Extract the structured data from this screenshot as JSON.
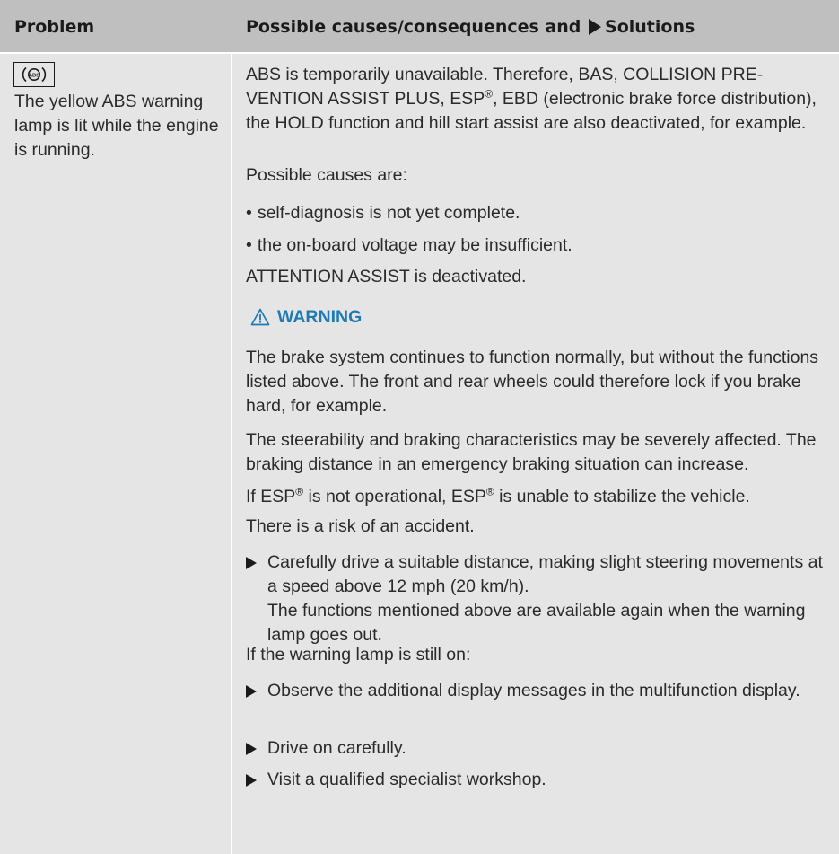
{
  "header": {
    "problem_label": "Problem",
    "solutions_prefix": "Possible causes/consequences and",
    "solutions_suffix": "Solutions"
  },
  "problem": {
    "icon_name": "abs-warning-lamp-icon",
    "text": "The yellow ABS warning lamp is lit while the engine is running."
  },
  "content": {
    "intro_a": "ABS is temporarily unavailable. Therefore, BAS, COLLISION PRE-VENTION ASSIST PLUS, ESP",
    "intro_b": ", EBD (electronic brake force distribution), the HOLD function and hill start assist are also deactivated, for example.",
    "reg_mark": "®",
    "possible_causes": "Possible causes are:",
    "bullets": [
      "self-diagnosis is not yet complete.",
      "the on-board voltage may be insufficient."
    ],
    "attention": "ATTENTION ASSIST is deactivated.",
    "warning_title": "WARNING",
    "warning_p1": "The brake system continues to function normally, but without the functions listed above. The front and rear wheels could therefore lock if you brake hard, for example.",
    "warning_p2": "The steerability and braking characteristics may be severely affected. The braking distance in an emergency braking situation can increase.",
    "esp_a": "If ESP",
    "esp_b": " is not operational, ESP",
    "esp_c": " is unable to stabilize the vehicle.",
    "risk": "There is a risk of an accident.",
    "step1_a": "Carefully drive a suitable distance, making slight steering movements at a speed above 12 mph (20 km/h).",
    "step1_b": "The functions mentioned above are available again when the warning lamp goes out.",
    "still_on": "If the warning lamp is still on:",
    "steps": [
      "Observe the additional display messages in the multifunction display.",
      "Drive on carefully.",
      "Visit a qualified specialist workshop."
    ],
    "warning_color": "#1f7ab3"
  }
}
